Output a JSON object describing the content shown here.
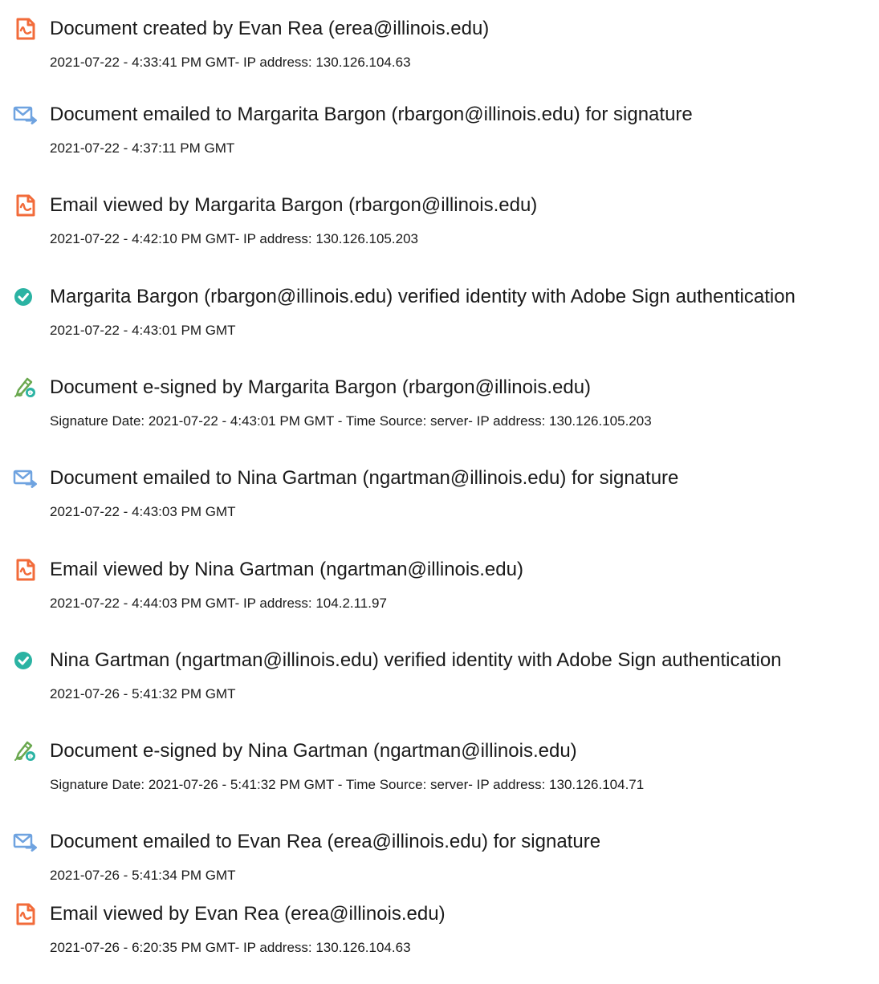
{
  "events": [
    {
      "icon": "document-created-icon",
      "text": "Document created by Evan Rea (erea@illinois.edu)",
      "detail": "2021-07-22 - 4:33:41 PM GMT- IP address: 130.126.104.63"
    },
    {
      "icon": "email-sent-icon",
      "text": "Document emailed to Margarita Bargon (rbargon@illinois.edu) for signature",
      "detail": "2021-07-22 - 4:37:11 PM GMT"
    },
    {
      "icon": "email-viewed-icon",
      "text": "Email viewed by Margarita Bargon (rbargon@illinois.edu)",
      "detail": "2021-07-22 - 4:42:10 PM GMT- IP address: 130.126.105.203"
    },
    {
      "icon": "verified-check-icon",
      "text": "Margarita Bargon (rbargon@illinois.edu) verified identity with Adobe Sign authentication",
      "detail": "2021-07-22 - 4:43:01 PM GMT"
    },
    {
      "icon": "e-sign-pen-icon",
      "text": "Document e-signed by Margarita Bargon (rbargon@illinois.edu)",
      "detail": "Signature Date: 2021-07-22 - 4:43:01 PM GMT - Time Source: server- IP address: 130.126.105.203"
    },
    {
      "icon": "email-sent-icon",
      "text": "Document emailed to Nina Gartman (ngartman@illinois.edu) for signature",
      "detail": "2021-07-22 - 4:43:03 PM GMT"
    },
    {
      "icon": "email-viewed-icon",
      "text": "Email viewed by Nina Gartman (ngartman@illinois.edu)",
      "detail": "2021-07-22 - 4:44:03 PM GMT- IP address: 104.2.11.97"
    },
    {
      "icon": "verified-check-icon",
      "text": "Nina Gartman (ngartman@illinois.edu) verified identity with Adobe Sign authentication",
      "detail": "2021-07-26 - 5:41:32 PM GMT"
    },
    {
      "icon": "e-sign-pen-icon",
      "text": "Document e-signed by Nina Gartman (ngartman@illinois.edu)",
      "detail": "Signature Date: 2021-07-26 - 5:41:32 PM GMT - Time Source: server- IP address: 130.126.104.71"
    },
    {
      "icon": "email-sent-icon",
      "text": "Document emailed to Evan Rea (erea@illinois.edu) for signature",
      "detail": "2021-07-26 - 5:41:34 PM GMT"
    },
    {
      "icon": "email-viewed-icon",
      "text": "Email viewed by Evan Rea (erea@illinois.edu)",
      "detail": "2021-07-26 - 6:20:35 PM GMT- IP address: 130.126.104.63"
    }
  ],
  "colors": {
    "document_icon": "#f26b3a",
    "email_icon": "#6fa3e0",
    "verified_icon": "#2bb3a3",
    "esign_icon": "#6aa84f",
    "text": "#1a1a1a"
  }
}
